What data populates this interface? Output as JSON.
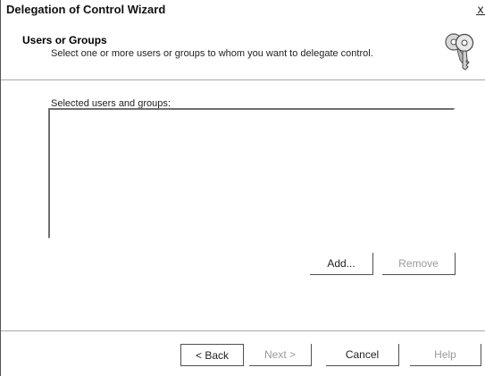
{
  "window": {
    "title": "Delegation of Control Wizard",
    "close_glyph": "x"
  },
  "header": {
    "title": "Users or Groups",
    "subtitle": "Select one or more users or groups to whom you want to delegate control.",
    "icon": "keys-icon"
  },
  "main": {
    "list_label": "Selected users and groups:",
    "list_items": [],
    "add_label": "Add...",
    "remove_label": "Remove",
    "remove_enabled": false
  },
  "footer": {
    "back_label": "< Back",
    "next_label": "Next >",
    "cancel_label": "Cancel",
    "help_label": "Help",
    "next_enabled": false,
    "help_enabled": false
  }
}
